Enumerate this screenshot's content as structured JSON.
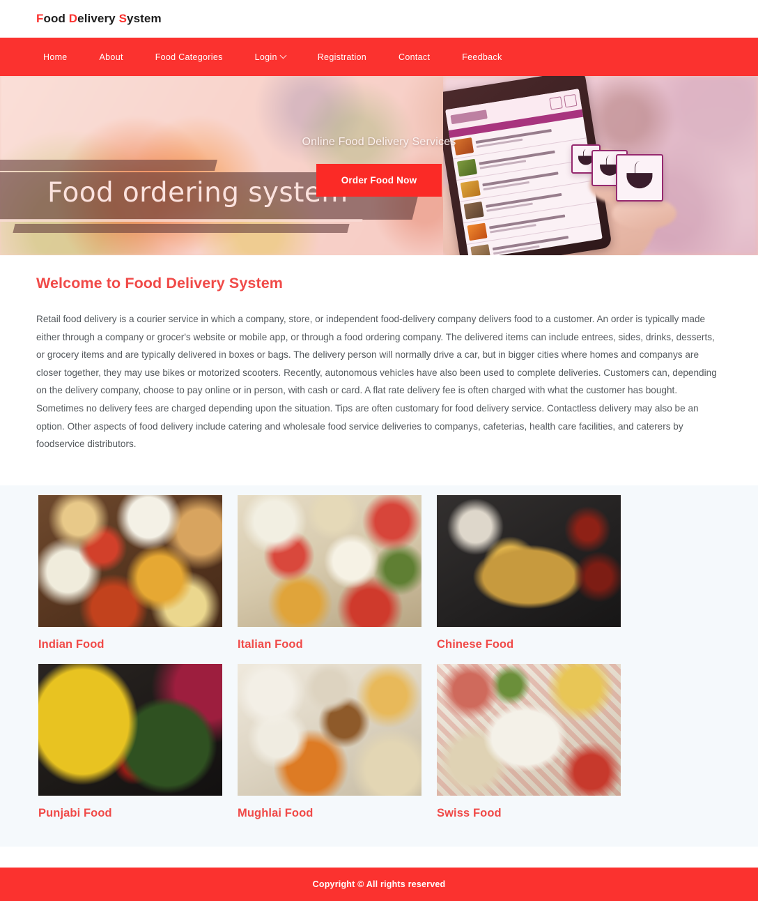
{
  "header": {
    "logo_full": "Food Delivery System",
    "logo_parts": [
      {
        "char": "F",
        "accent": true
      },
      {
        "char": "ood ",
        "accent": false
      },
      {
        "char": "D",
        "accent": true
      },
      {
        "char": "elivery ",
        "accent": false
      },
      {
        "char": "S",
        "accent": true
      },
      {
        "char": "ystem",
        "accent": false
      }
    ]
  },
  "nav": {
    "items": [
      {
        "label": "Home",
        "has_dropdown": false
      },
      {
        "label": "About",
        "has_dropdown": false
      },
      {
        "label": "Food Categories",
        "has_dropdown": false
      },
      {
        "label": "Login",
        "has_dropdown": true
      },
      {
        "label": "Registration",
        "has_dropdown": false
      },
      {
        "label": "Contact",
        "has_dropdown": false
      },
      {
        "label": "Feedback",
        "has_dropdown": false
      }
    ]
  },
  "hero": {
    "subtitle": "Online Food Delivery Services",
    "cta_label": "Order Food Now",
    "banner_title": "Food ordering system",
    "image_alt": "hand holding a smartphone showing a food ordering app with floating food cards"
  },
  "about": {
    "heading": "Welcome to Food Delivery System",
    "paragraph": "Retail food delivery is a courier service in which a company, store, or independent food-delivery company delivers food to a customer. An order is typically made either through a company or grocer's website or mobile app, or through a food ordering company. The delivered items can include entrees, sides, drinks, desserts, or grocery items and are typically delivered in boxes or bags. The delivery person will normally drive a car, but in bigger cities where homes and companys are closer together, they may use bikes or motorized scooters. Recently, autonomous vehicles have also been used to complete deliveries. Customers can, depending on the delivery company, choose to pay online or in person, with cash or card. A flat rate delivery fee is often charged with what the customer has bought. Sometimes no delivery fees are charged depending upon the situation. Tips are often customary for food delivery service. Contactless delivery may also be an option. Other aspects of food delivery include catering and wholesale food service deliveries to companys, cafeterias, health care facilities, and caterers by foodservice distributors."
  },
  "categories": {
    "items": [
      {
        "label": "Indian Food",
        "image_class": "food-indian",
        "image_alt": "assorted indian curries, rice and breads on a wooden table"
      },
      {
        "label": "Italian Food",
        "image_class": "food-italian",
        "image_alt": "pizza, pasta and caprese salad spread"
      },
      {
        "label": "Chinese Food",
        "image_class": "food-chinese",
        "image_alt": "bowl of hakka noodles with vegetables, garlic and dried chillies"
      },
      {
        "label": "Punjabi Food",
        "image_class": "food-punjabi",
        "image_alt": "makki di roti with sarson da saag and butter"
      },
      {
        "label": "Mughlai Food",
        "image_class": "food-mughlai",
        "image_alt": "biryani, curries and naan served in bowls"
      },
      {
        "label": "Swiss Food",
        "image_class": "food-swiss",
        "image_alt": "raclette skillet with cheese, bread and cold cuts"
      }
    ]
  },
  "footer": {
    "copyright": "Copyright © All rights reserved"
  },
  "colors": {
    "brand_red": "#fb322f",
    "cta_red": "#fb2a26",
    "heading_red": "#f04a48",
    "body_text": "#555a5e",
    "section_bg": "#f5f9fc",
    "page_bg": "#ffffff"
  }
}
